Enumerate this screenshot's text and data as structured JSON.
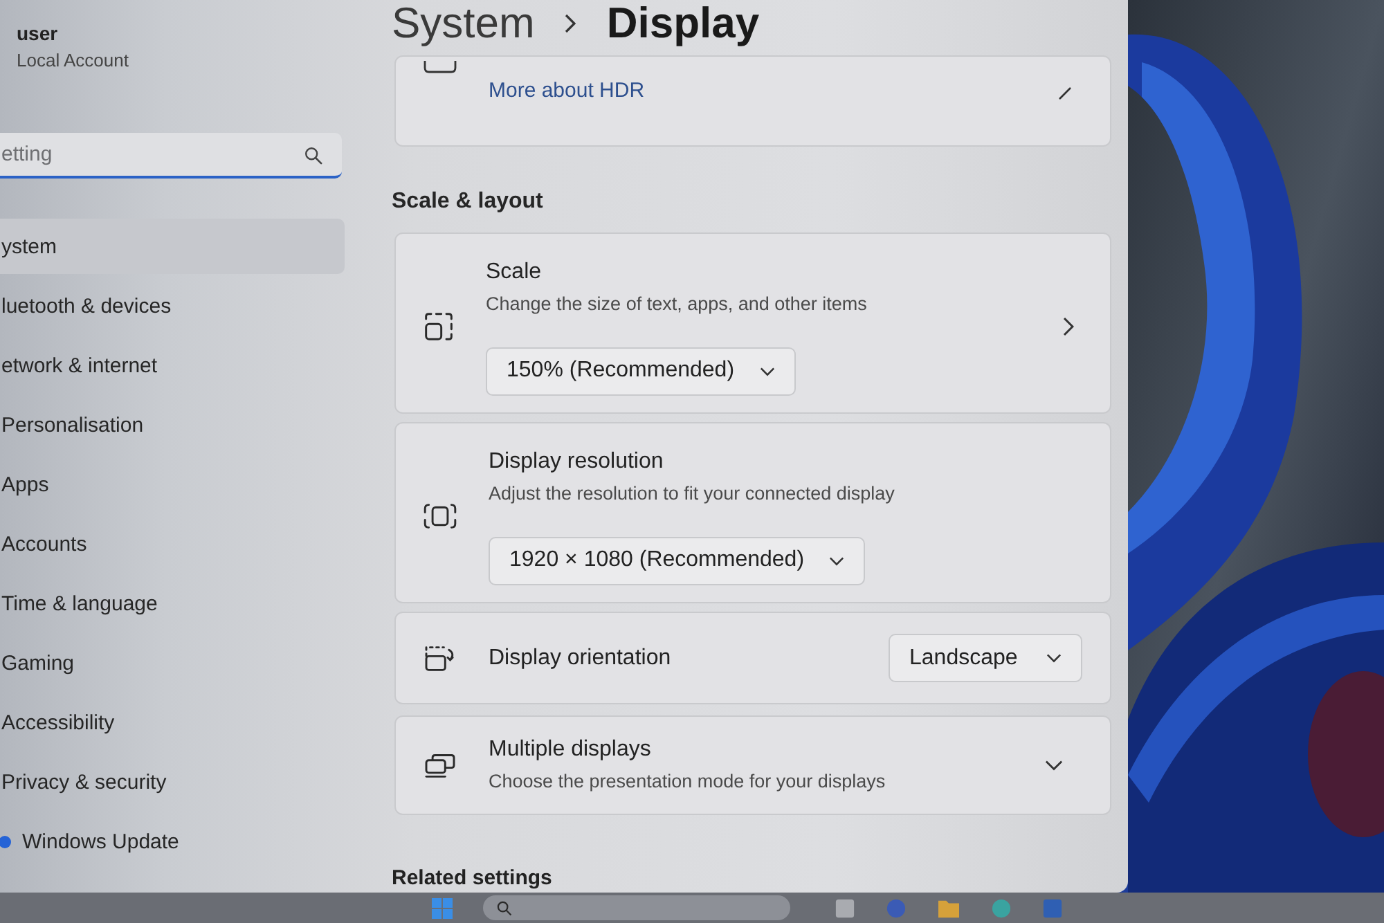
{
  "account": {
    "name": "user",
    "type": "Local Account"
  },
  "search": {
    "placeholder": "etting"
  },
  "nav": [
    {
      "label": "ystem",
      "selected": true
    },
    {
      "label": "luetooth & devices",
      "selected": false
    },
    {
      "label": "etwork & internet",
      "selected": false
    },
    {
      "label": "Personalisation",
      "selected": false
    },
    {
      "label": "Apps",
      "selected": false
    },
    {
      "label": "Accounts",
      "selected": false
    },
    {
      "label": "Time & language",
      "selected": false
    },
    {
      "label": "Gaming",
      "selected": false
    },
    {
      "label": "Accessibility",
      "selected": false
    },
    {
      "label": "Privacy & security",
      "selected": false
    },
    {
      "label": "Windows Update",
      "selected": false
    }
  ],
  "breadcrumb": {
    "parent": "System",
    "current": "Display"
  },
  "hdr_card": {
    "link": "More about HDR"
  },
  "section": {
    "title": "Scale & layout"
  },
  "settings": [
    {
      "kind": "stacked",
      "title": "Scale",
      "description": "Change the size of text, apps, and other items",
      "value": "150% (Recommended)",
      "navigates": true
    },
    {
      "kind": "stacked",
      "title": "Display resolution",
      "description": "Adjust the resolution to fit your connected display",
      "value": "1920 × 1080 (Recommended)",
      "navigates": false
    },
    {
      "kind": "inline",
      "title": "Display orientation",
      "value": "Landscape"
    },
    {
      "kind": "expander",
      "title": "Multiple displays",
      "description": "Choose the presentation mode for your displays",
      "expanded": false
    }
  ],
  "related": {
    "title": "Related settings"
  }
}
